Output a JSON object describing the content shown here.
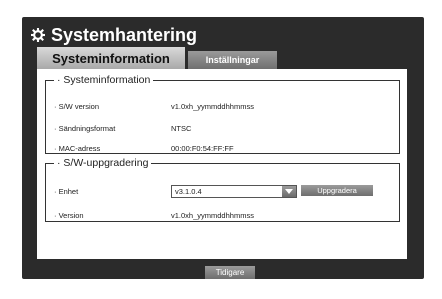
{
  "window": {
    "title": "Systemhantering",
    "tabs": [
      "Systeminformation",
      "Inställningar"
    ]
  },
  "system_info": {
    "legend": "· Systeminformation",
    "rows": [
      {
        "label": "· S/W version",
        "value": "v1.0xh_yymmddhhmmss"
      },
      {
        "label": "· Sändningsformat",
        "value": "NTSC"
      },
      {
        "label": "· MAC-adress",
        "value": "00:00:F0:54:FF:FF"
      }
    ]
  },
  "upgrade": {
    "legend": "· S/W-uppgradering",
    "device_label": "· Enhet",
    "device_value": "v3.1.0.4",
    "upgrade_button": "Uppgradera",
    "version_label": "· Version",
    "version_value": "v1.0xh_yymmddhhmmss"
  },
  "footer": {
    "back_button": "Tidigare"
  },
  "icons": {
    "title_icon": "gear-icon",
    "dropdown_icon": "chevron-down-icon"
  }
}
